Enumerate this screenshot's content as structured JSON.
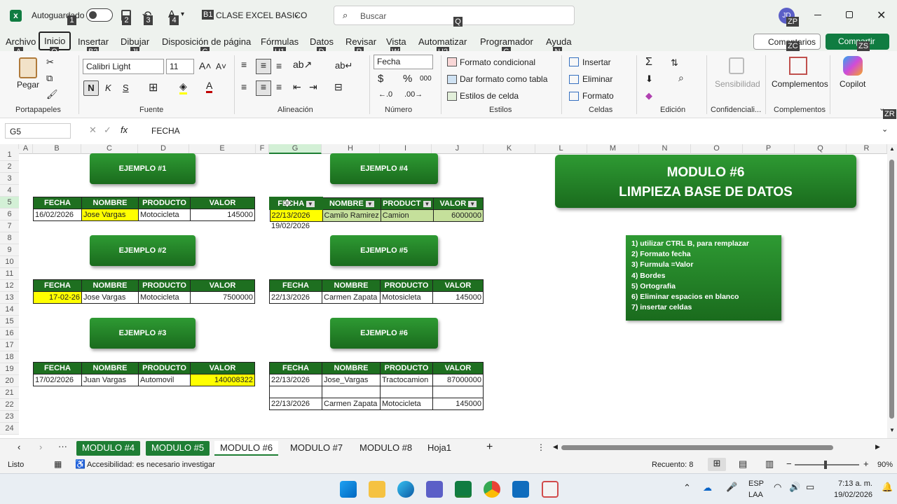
{
  "titlebar": {
    "autosave_label": "Autoguardado",
    "doc_title": "CLASE EXCEL BASICO",
    "search_placeholder": "Buscar",
    "user_initials": "JD"
  },
  "keytips": {
    "k1": "1",
    "k2": "2",
    "k3": "3",
    "k4": "4",
    "b1": "B1",
    "q": "Q",
    "zp": "ZP",
    "a": "A",
    "o": "O",
    "b2": "B2",
    "j": "JI",
    "c": "C",
    "u1": "U1",
    "d": "D",
    "r": "R",
    "w": "W",
    "u2": "U2",
    "g": "G",
    "n": "N",
    "zc": "ZC",
    "zs": "ZS",
    "zr": "ZR"
  },
  "menu": [
    "Archivo",
    "Inicio",
    "Insertar",
    "Dibujar",
    "Disposición de página",
    "Fórmulas",
    "Datos",
    "Revisar",
    "Vista",
    "Automatizar",
    "Programador",
    "Ayuda"
  ],
  "menu_right": {
    "comments": "Comentarios",
    "share": "Compartir"
  },
  "ribbon": {
    "paste": "Pegar",
    "clipboard": "Portapapeles",
    "font_name": "Calibri Light",
    "font_size": "11",
    "bold": "N",
    "italic": "K",
    "underline": "S",
    "font_group": "Fuente",
    "align_group": "Alineación",
    "number_format": "Fecha",
    "currency": "$",
    "percent": "%",
    "thousands": "000",
    "number_group": "Número",
    "cond_format": "Formato condicional",
    "table_format": "Dar formato como tabla",
    "cell_styles": "Estilos de celda",
    "styles_group": "Estilos",
    "insert": "Insertar",
    "delete": "Eliminar",
    "format": "Formato",
    "cells_group": "Celdas",
    "edit_group": "Edición",
    "sensitivity": "Sensibilidad",
    "conf_group": "Confidenciali...",
    "addins": "Complementos",
    "addins_group": "Complementos",
    "copilot": "Copilot"
  },
  "formula": {
    "namebox": "G5",
    "value": "FECHA",
    "fx": "fx"
  },
  "columns": [
    "A",
    "B",
    "C",
    "D",
    "E",
    "F",
    "G",
    "H",
    "I",
    "J",
    "K",
    "L",
    "M",
    "N",
    "O",
    "P",
    "Q",
    "R"
  ],
  "rows": [
    "1",
    "2",
    "3",
    "4",
    "5",
    "6",
    "7",
    "8",
    "9",
    "10",
    "11",
    "12",
    "13",
    "14",
    "15",
    "16",
    "17",
    "18",
    "19",
    "20",
    "21",
    "22",
    "23",
    "24"
  ],
  "buttons": {
    "e1": "EJEMPLO #1",
    "e2": "EJEMPLO #2",
    "e3": "EJEMPLO #3",
    "e4": "EJEMPLO #4",
    "e5": "EJEMPLO #5",
    "e6": "EJEMPLO #6"
  },
  "headers": {
    "fecha": "FECHA",
    "nombre": "NOMBRE",
    "producto": "PRODUCTO",
    "valor": "VALOR",
    "fecha_f": "FECHA",
    "nombre_f": "NOMBRE",
    "producto_f": "PRODUCT",
    "valor_f": "VALOR"
  },
  "t1": {
    "fecha": "16/02/2026",
    "nombre": "Jose Vargas",
    "producto": "Motocicleta",
    "valor": "145000"
  },
  "t2": {
    "fecha": "17-02-26",
    "nombre": "Jose Vargas",
    "producto": "Motocicleta",
    "valor": "7500000"
  },
  "t3": {
    "fecha": "17/02/2026",
    "nombre": "Juan Vargas",
    "producto": "Automovil",
    "valor": "140008322"
  },
  "t4": {
    "fecha": "22/13/2026",
    "nombre": "Camilo Ramirez",
    "producto": "Camion",
    "valor": "6000000",
    "extra": "19/02/2026"
  },
  "t5": {
    "fecha": "22/13/2026",
    "nombre": "Carmen Zapata",
    "producto": "Motosicleta",
    "valor": "145000"
  },
  "t6": {
    "r1": {
      "fecha": "22/13/2026",
      "nombre": "Jose_Vargas",
      "producto": "Tractocamion",
      "valor": "87000000"
    },
    "r2": {
      "fecha": "22/13/2026",
      "nombre": "Carmen Zapata",
      "producto": "Motocicleta",
      "valor": "145000"
    }
  },
  "module": {
    "line1": "MODULO #6",
    "line2": "LIMPIEZA BASE DE DATOS"
  },
  "tasks": [
    "1) utilizar CTRL B, para remplazar",
    "2) Formato fecha",
    "3) Furmula =Valor",
    "4) Bordes",
    "5) Ortografia",
    "6) Eliminar espacios en blanco",
    "7) insertar celdas"
  ],
  "sheets": [
    "MODULO #4",
    "MODULO #5",
    "MODULO #6",
    "MODULO #7",
    "MODULO #8",
    "Hoja1"
  ],
  "status": {
    "ready": "Listo",
    "accessibility": "Accesibilidad: es necesario investigar",
    "count": "Recuento: 8",
    "zoom": "90%"
  },
  "taskbar": {
    "lang1": "ESP",
    "lang2": "LAA",
    "time": "7:13 a. m.",
    "date": "19/02/2026"
  },
  "colors": {
    "green_dark": "#1e6f20",
    "green_excel": "#107c41",
    "highlight": "#ffff00",
    "sel_green": "#c5e09b"
  }
}
